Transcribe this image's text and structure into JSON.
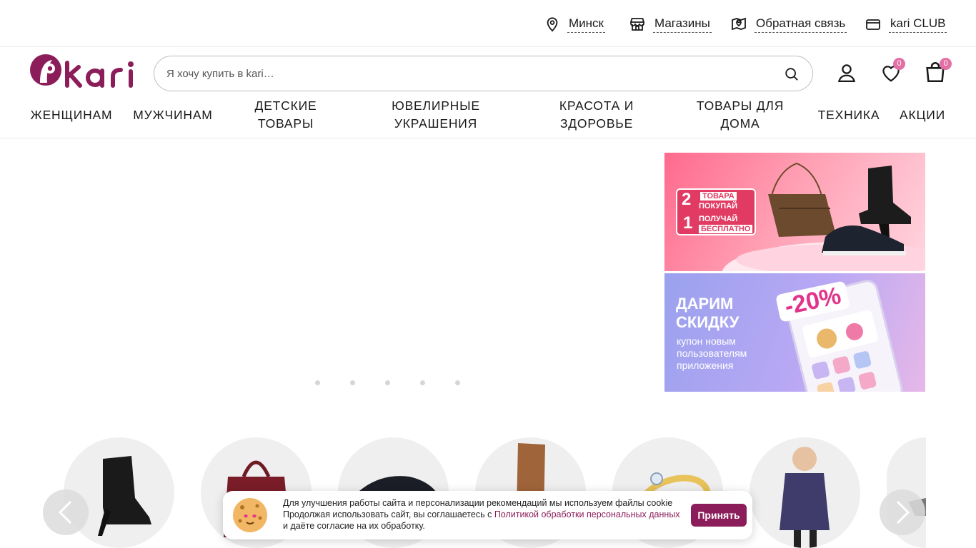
{
  "topbar": {
    "city": "Минск",
    "stores": "Магазины",
    "feedback": "Обратная связь",
    "club": "kari CLUB"
  },
  "header": {
    "search_placeholder": "Я хочу купить в kari…",
    "favorites_count": "0",
    "cart_count": "0"
  },
  "nav": [
    {
      "label": "Женщинам"
    },
    {
      "label": "Мужчинам"
    },
    {
      "label": "Детские товары"
    },
    {
      "label": "Ювелирные украшения"
    },
    {
      "label": "Красота и здоровье"
    },
    {
      "label": "Товары для дома"
    },
    {
      "label": "Техника"
    },
    {
      "label": "Акции"
    }
  ],
  "banners": [
    {
      "line1": "ТОВАРА",
      "line2": "ПОКУПАЙ",
      "line3": "ПОЛУЧАЙ",
      "line4": "БЕСПЛАТНО",
      "num_top": "2",
      "num_bottom": "1"
    },
    {
      "title1": "ДАРИМ",
      "title2": "СКИДКУ",
      "discount": "-20%",
      "sub1": "купон новым",
      "sub2": "пользователям",
      "sub3": "приложения"
    }
  ],
  "slider": {
    "dot_count": 5,
    "active_index": 0
  },
  "categories": [
    {
      "icon": "ankle-boot"
    },
    {
      "icon": "handbag"
    },
    {
      "icon": "shoe"
    },
    {
      "icon": "tall-boot"
    },
    {
      "icon": "ring"
    },
    {
      "icon": "kids-jacket"
    },
    {
      "icon": "sneaker"
    }
  ],
  "cookie": {
    "text1": "Для улучшения работы сайта и персонализации рекомендаций мы используем файлы cookie",
    "text2": "Продолжая использовать сайт, вы соглашаетесь с ",
    "link": "Политикой обработки персональных данных",
    "text3": " и даёте согласие на их обработку.",
    "accept": "Принять"
  },
  "colors": {
    "brand": "#8b1e5a",
    "badge": "#e36fa5"
  }
}
